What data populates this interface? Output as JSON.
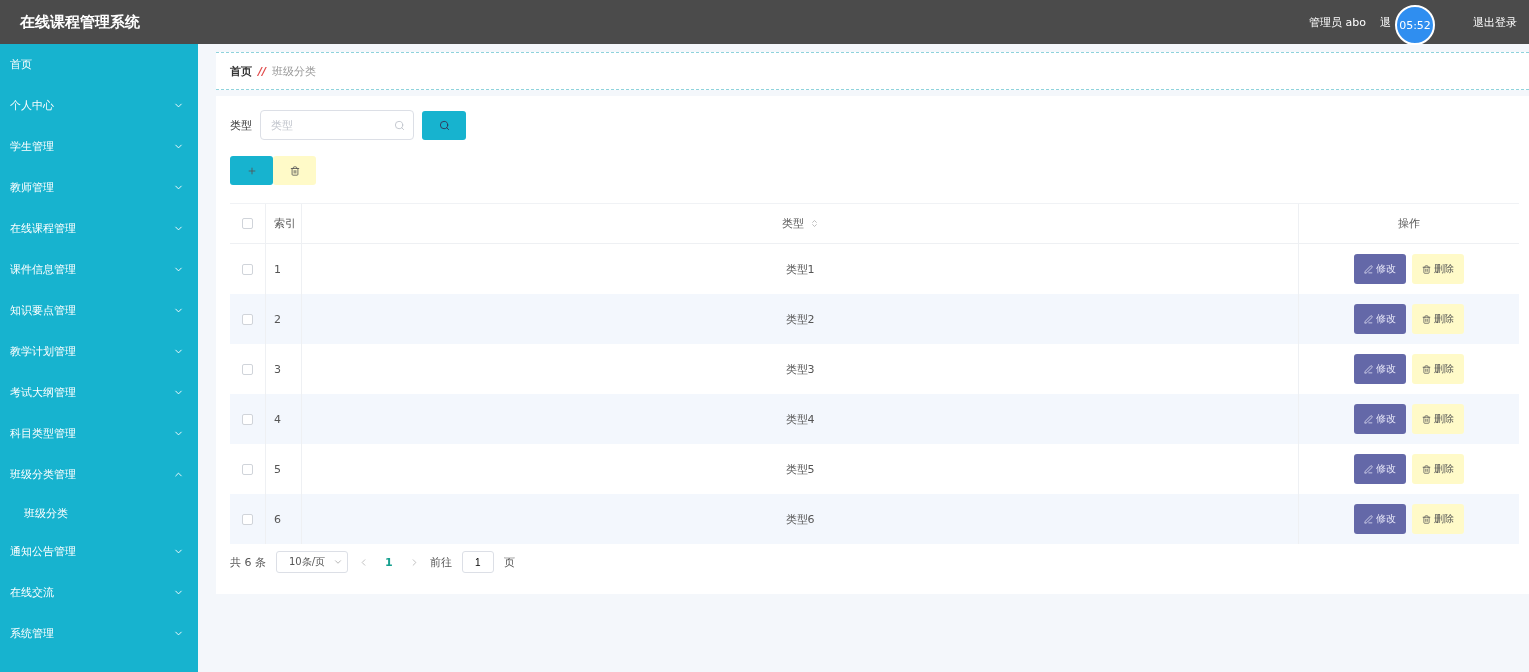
{
  "header": {
    "title": "在线课程管理系统",
    "user": "管理员 abo",
    "partial_link": "退",
    "timer": "05:52",
    "logout": "退出登录"
  },
  "sidebar": {
    "items": [
      {
        "label": "首页",
        "has_arrow": false
      },
      {
        "label": "个人中心",
        "has_arrow": true,
        "expanded": false
      },
      {
        "label": "学生管理",
        "has_arrow": true,
        "expanded": false
      },
      {
        "label": "教师管理",
        "has_arrow": true,
        "expanded": false
      },
      {
        "label": "在线课程管理",
        "has_arrow": true,
        "expanded": false
      },
      {
        "label": "课件信息管理",
        "has_arrow": true,
        "expanded": false
      },
      {
        "label": "知识要点管理",
        "has_arrow": true,
        "expanded": false
      },
      {
        "label": "教学计划管理",
        "has_arrow": true,
        "expanded": false
      },
      {
        "label": "考试大纲管理",
        "has_arrow": true,
        "expanded": false
      },
      {
        "label": "科目类型管理",
        "has_arrow": true,
        "expanded": false
      },
      {
        "label": "班级分类管理",
        "has_arrow": true,
        "expanded": true,
        "children": [
          {
            "label": "班级分类"
          }
        ]
      },
      {
        "label": "通知公告管理",
        "has_arrow": true,
        "expanded": false
      },
      {
        "label": "在线交流",
        "has_arrow": true,
        "expanded": false
      },
      {
        "label": "系统管理",
        "has_arrow": true,
        "expanded": false
      }
    ]
  },
  "breadcrumb": {
    "home": "首页",
    "separator": "//",
    "current": "班级分类"
  },
  "search": {
    "label": "类型",
    "placeholder": "类型"
  },
  "table": {
    "columns": [
      "索引",
      "类型",
      "操作"
    ],
    "rows": [
      {
        "index": "1",
        "type": "类型1",
        "checked": false,
        "edit": "修改",
        "delete": "删除"
      },
      {
        "index": "2",
        "type": "类型2",
        "checked": false,
        "edit": "修改",
        "delete": "删除"
      },
      {
        "index": "3",
        "type": "类型3",
        "checked": false,
        "edit": "修改",
        "delete": "删除"
      },
      {
        "index": "4",
        "type": "类型4",
        "checked": false,
        "edit": "修改",
        "delete": "删除"
      },
      {
        "index": "5",
        "type": "类型5",
        "checked": false,
        "edit": "修改",
        "delete": "删除"
      },
      {
        "index": "6",
        "type": "类型6",
        "checked": false,
        "edit": "修改",
        "delete": "删除"
      }
    ],
    "all_checked": false
  },
  "pagination": {
    "total": "共 6 条",
    "page_size": "10条/页",
    "pages": [
      {
        "label": "1",
        "selected": true
      }
    ],
    "goto_label": "前往",
    "goto_value": "1",
    "page_unit": "页"
  }
}
